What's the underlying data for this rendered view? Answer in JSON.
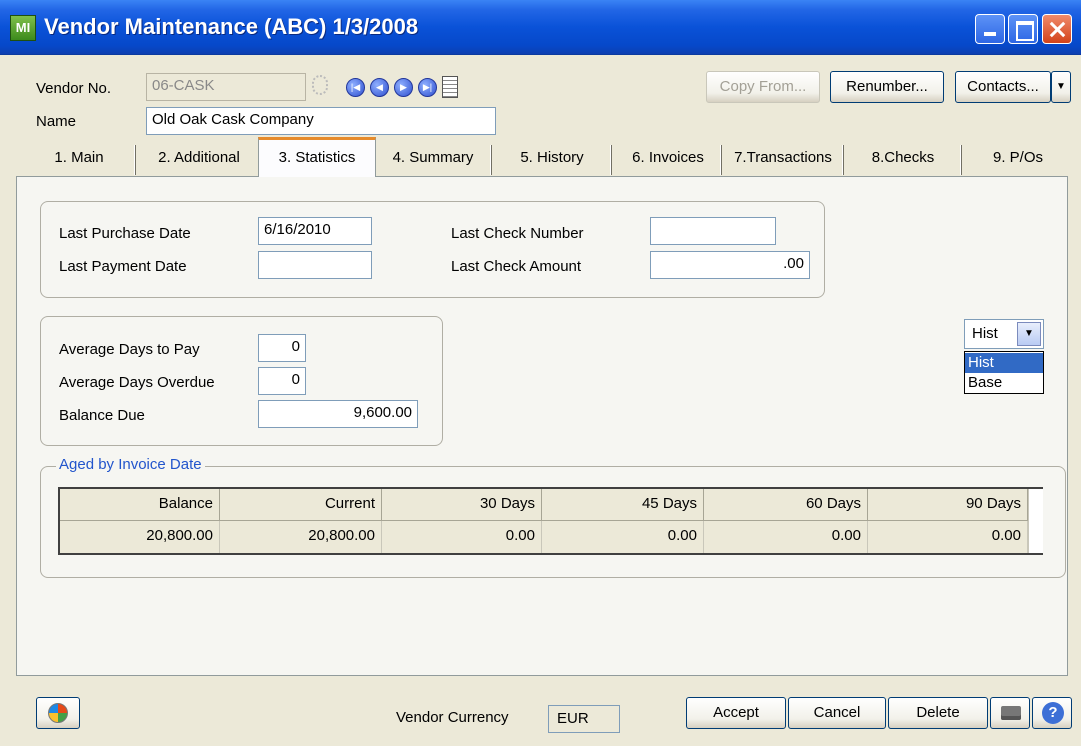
{
  "window": {
    "title": "Vendor Maintenance (ABC) 1/3/2008",
    "icon_text": "MI"
  },
  "header": {
    "vendor_no_label": "Vendor No.",
    "vendor_no_value": "06-CASK",
    "name_label": "Name",
    "name_value": "Old Oak Cask Company",
    "copy_from": "Copy From...",
    "renumber": "Renumber...",
    "contacts": "Contacts..."
  },
  "tabs": [
    {
      "label": "1. Main"
    },
    {
      "label": "2. Additional"
    },
    {
      "label": "3. Statistics"
    },
    {
      "label": "4. Summary"
    },
    {
      "label": "5. History"
    },
    {
      "label": "6. Invoices"
    },
    {
      "label": "7.Transactions"
    },
    {
      "label": "8.Checks"
    },
    {
      "label": "9. P/Os"
    }
  ],
  "statistics": {
    "last_purchase_date_label": "Last Purchase Date",
    "last_purchase_date": "6/16/2010",
    "last_payment_date_label": "Last Payment Date",
    "last_payment_date": "",
    "last_check_number_label": "Last Check Number",
    "last_check_number": "",
    "last_check_amount_label": "Last Check Amount",
    "last_check_amount": ".00",
    "avg_days_to_pay_label": "Average Days to Pay",
    "avg_days_to_pay": "0",
    "avg_days_overdue_label": "Average Days Overdue",
    "avg_days_overdue": "0",
    "balance_due_label": "Balance Due",
    "balance_due": "9,600.00"
  },
  "hist_combo": {
    "selected": "Hist",
    "options": [
      "Hist",
      "Base"
    ]
  },
  "aged": {
    "title": "Aged by Invoice Date",
    "columns": [
      "Balance",
      "Current",
      "30 Days",
      "45 Days",
      "60 Days",
      "90 Days"
    ],
    "values": [
      "20,800.00",
      "20,800.00",
      "0.00",
      "0.00",
      "0.00",
      "0.00"
    ]
  },
  "footer": {
    "vendor_currency_label": "Vendor Currency",
    "vendor_currency": "EUR",
    "accept": "Accept",
    "cancel": "Cancel",
    "delete": "Delete"
  }
}
